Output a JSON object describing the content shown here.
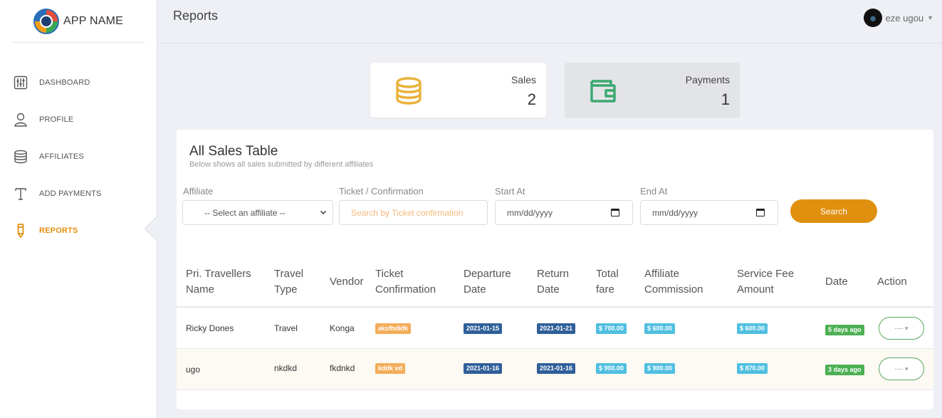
{
  "app": {
    "name": "APP NAME"
  },
  "sidebar": {
    "items": [
      {
        "label": "DASHBOARD",
        "icon": "sliders-icon"
      },
      {
        "label": "PROFILE",
        "icon": "user-icon"
      },
      {
        "label": "AFFILIATES",
        "icon": "database-icon"
      },
      {
        "label": "ADD PAYMENTS",
        "icon": "text-icon"
      },
      {
        "label": "REPORTS",
        "icon": "pen-icon",
        "active": true
      }
    ]
  },
  "header": {
    "title": "Reports",
    "user_name": "eze ugou"
  },
  "stats": {
    "sales": {
      "label": "Sales",
      "value": "2",
      "icon": "coins-icon",
      "color": "#e8b23a"
    },
    "payments": {
      "label": "Payments",
      "value": "1",
      "icon": "wallet-icon",
      "color": "#3aa870"
    }
  },
  "table_panel": {
    "title": "All Sales Table",
    "subtitle": "Below shows all sales submitted by different affiliates",
    "filters": {
      "affiliate_label": "Affiliate",
      "affiliate_value": "-- Select an affiliate --",
      "ticket_label": "Ticket / Confirmation",
      "ticket_placeholder": "Search by Ticket confirmation",
      "start_label": "Start At",
      "start_value": "mm/dd/yyyy",
      "end_label": "End At",
      "end_value": "mm/dd/yyyy",
      "search_label": "Search"
    },
    "columns": [
      [
        "Pri. Travellers",
        "Name"
      ],
      [
        "Travel",
        "Type"
      ],
      [
        "Vendor"
      ],
      [
        "Ticket",
        "Confirmation"
      ],
      [
        "Departure",
        "Date"
      ],
      [
        "Return",
        "Date"
      ],
      [
        "Total",
        "fare"
      ],
      [
        "Affiliate",
        "Commission"
      ],
      [
        "Service Fee",
        "Amount"
      ],
      [
        "Date"
      ],
      [
        "Action"
      ]
    ],
    "rows": [
      {
        "name": "Ricky Dones",
        "type": "Travel",
        "vendor": "Konga",
        "ticket": "aksfhdkfk",
        "departure": "2021-01-15",
        "return": "2021-01-21",
        "total": "$ 700.00",
        "commission": "$ 600.00",
        "service_fee": "$ 600.00",
        "date": "5 days ago",
        "action": "---- ▾"
      },
      {
        "name": "ugo",
        "type": "nkdkd",
        "vendor": "fkdnkd",
        "ticket": "kddk vd",
        "departure": "2021-01-16",
        "return": "2021-01-16",
        "total": "$ 900.00",
        "commission": "$ 900.00",
        "service_fee": "$ 870.00",
        "date": "3 days ago",
        "action": "---- ▾"
      }
    ]
  },
  "colors": {
    "accent": "#e0900f",
    "navy": "#2f5f99",
    "cyan": "#4fbfe0",
    "green": "#4db054",
    "orange": "#f3ad5a"
  }
}
